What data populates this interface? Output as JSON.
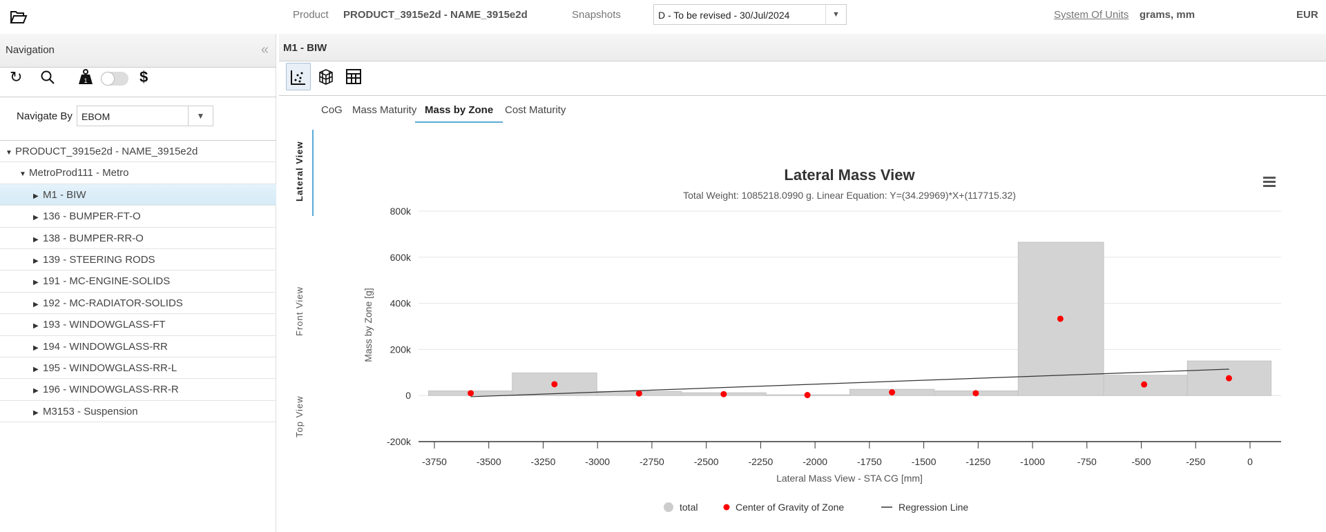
{
  "header": {
    "open_icon": "folder-open-icon",
    "product_label": "Product",
    "product_value": "PRODUCT_3915e2d - NAME_3915e2d",
    "snapshots_label": "Snapshots",
    "snapshot_selected": "D - To be revised - 30/Jul/2024",
    "units_link": "System Of Units",
    "units_value": "grams, mm",
    "currency": "EUR"
  },
  "sidebar": {
    "title": "Navigation",
    "navigate_by_label": "Navigate By",
    "navigate_by_value": "EBOM",
    "tree": [
      {
        "label": "PRODUCT_3915e2d - NAME_3915e2d",
        "level": 0,
        "expanded": true
      },
      {
        "label": "MetroProd111 - Metro",
        "level": 1,
        "expanded": true
      },
      {
        "label": "M1 - BIW",
        "level": 2,
        "selected": true
      },
      {
        "label": "136 - BUMPER-FT-O",
        "level": 2
      },
      {
        "label": "138 - BUMPER-RR-O",
        "level": 2
      },
      {
        "label": "139 - STEERING RODS",
        "level": 2
      },
      {
        "label": "191 - MC-ENGINE-SOLIDS",
        "level": 2
      },
      {
        "label": "192 - MC-RADIATOR-SOLIDS",
        "level": 2
      },
      {
        "label": "193 - WINDOWGLASS-FT",
        "level": 2
      },
      {
        "label": "194 - WINDOWGLASS-RR",
        "level": 2
      },
      {
        "label": "195 - WINDOWGLASS-RR-L",
        "level": 2
      },
      {
        "label": "196 - WINDOWGLASS-RR-R",
        "level": 2
      },
      {
        "label": "M3153 - Suspension",
        "level": 2
      }
    ]
  },
  "main": {
    "title": "M1 - BIW",
    "tabs": [
      "CoG",
      "Mass Maturity",
      "Mass by Zone",
      "Cost Maturity"
    ],
    "active_tab": "Mass by Zone",
    "view_tabs": [
      "Lateral View",
      "Front View",
      "Top View"
    ],
    "active_view": "Lateral View"
  },
  "colors": {
    "bar": "#d3d3d3",
    "point": "#ff0000",
    "line": "#333333",
    "accent": "#5aaad8"
  },
  "chart_data": {
    "type": "bar",
    "title": "Lateral Mass View",
    "subtitle": "Total Weight: 1085218.0990 g. Linear Equation: Y=(34.29969)*X+(117715.32)",
    "xlabel": "Lateral Mass View - STA CG [mm]",
    "ylabel": "Mass by Zone [g]",
    "xlim": [
      -3850,
      130
    ],
    "ylim": [
      -200000,
      800000
    ],
    "xticks": [
      -3750,
      -3500,
      -3250,
      -3000,
      -2750,
      -2500,
      -2250,
      -2000,
      -1750,
      -1500,
      -1250,
      -1000,
      -750,
      -500,
      -250,
      0
    ],
    "yticks": [
      -200000,
      0,
      200000,
      400000,
      600000,
      800000
    ],
    "ytick_labels": [
      "-200k",
      "0",
      "200k",
      "400k",
      "600k",
      "800k"
    ],
    "bins": [
      [
        -3777,
        -3392
      ],
      [
        -3392,
        -3003
      ],
      [
        -3003,
        -2614
      ],
      [
        -2614,
        -2225
      ],
      [
        -2225,
        -1840
      ],
      [
        -1840,
        -1451
      ],
      [
        -1451,
        -1066
      ],
      [
        -1066,
        -673
      ],
      [
        -673,
        -288
      ],
      [
        -288,
        97
      ]
    ],
    "series": [
      {
        "name": "total",
        "type": "column",
        "values": [
          20000,
          98000,
          18000,
          12000,
          3000,
          27000,
          20000,
          665000,
          88000,
          150000
        ]
      },
      {
        "name": "Center of Gravity of Zone",
        "type": "scatter",
        "x": [
          -3583,
          -3198,
          -2809,
          -2420,
          -2035,
          -1646,
          -1261,
          -872,
          -487,
          -97
        ],
        "y": [
          10000,
          49000,
          9000,
          6000,
          2000,
          14000,
          10000,
          333000,
          48000,
          75000
        ]
      },
      {
        "name": "Regression Line",
        "type": "line",
        "x": [
          -3583,
          -97
        ],
        "y": [
          -5180,
          114388
        ]
      }
    ],
    "legend": [
      "total",
      "Center of Gravity of Zone",
      "Regression Line"
    ],
    "legend_position": "bottom",
    "menu_icon": "hamburger-menu-icon"
  }
}
